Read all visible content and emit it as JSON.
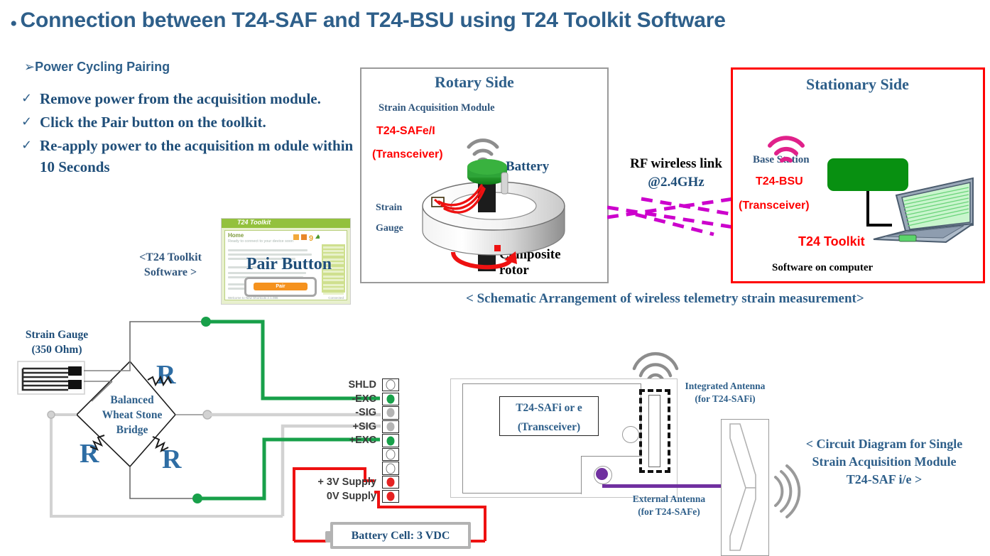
{
  "title": {
    "bullet": "•",
    "text": "Connection between T24-SAF and T24-BSU using T24 Toolkit Software",
    "color": "#2E5F8A"
  },
  "instructions": {
    "heading_arrow": "➢",
    "heading": "Power Cycling  Pairing",
    "check_glyph": "✓",
    "steps": [
      "Remove power from the acquisition module.",
      "Click the Pair button on the toolkit.",
      "Re-apply power to the acquisition m odule within 10 Seconds"
    ]
  },
  "toolkit_screenshot": {
    "window_title": "T24 Toolkit",
    "home_label": "Home",
    "subtitle": "Ready to connect to your device soon",
    "pair_button": "Pair",
    "footer_left": "Welcome to New Shortcuts 2.1.086",
    "footer_right": "Connected",
    "overlay_label": "Pair Button",
    "caption": "<T24 Toolkit Software >"
  },
  "rotary": {
    "panel_title": "Rotary Side",
    "module_label": "Strain Acquisition Module",
    "device_label": "T24-SAFe/I",
    "device_sub": "(Transceiver)",
    "battery_label": "Battery",
    "strain_label": "Strain",
    "gauge_label": "Gauge",
    "rotor_label": "Composite rotor",
    "border_color": "#9a9a9a"
  },
  "rf_link": {
    "line1": "RF wireless link",
    "line2": "@2.4GHz",
    "dash_color": "#CC00CC"
  },
  "stationary": {
    "panel_title": "Stationary  Side",
    "base_station_label": "Base Station",
    "device_label": "T24-BSU",
    "device_sub": "(Transceiver)",
    "toolkit_label": "T24 Toolkit",
    "software_label": "Software  on computer",
    "border_color": "#FF0000"
  },
  "schematic_caption": "< Schematic Arrangement of wireless telemetry strain measurement>",
  "circuit": {
    "strain_gauge_label": "Strain Gauge (350 Ohm)",
    "bridge_label": "Balanced Wheat Stone Bridge",
    "resistor_label": "R",
    "resistors": [
      "R",
      "R",
      "R"
    ],
    "terminals": [
      {
        "label": "SHLD",
        "dot": "empty"
      },
      {
        "label": "-EXC",
        "dot": "green"
      },
      {
        "label": "-SIG",
        "dot": "grey"
      },
      {
        "label": "+SIG",
        "dot": "grey"
      },
      {
        "label": "+EXC",
        "dot": "green"
      },
      {
        "label": "",
        "dot": "empty"
      },
      {
        "label": "",
        "dot": "empty"
      },
      {
        "label": "+ 3V Supply",
        "dot": "red"
      },
      {
        "label": "0V Supply",
        "dot": "red"
      }
    ],
    "module_label_line1": "T24-SAFi  or e",
    "module_label_line2": "(Transceiver)",
    "integrated_antenna_label": "Integrated Antenna (for T24-SAFi)",
    "external_antenna_label": "External Antenna (for T24-SAFe)",
    "battery_cell_label": "Battery  Cell: 3 VDC",
    "caption": "< Circuit Diagram for Single Strain Acquisition Module T24-SAF i/e >",
    "wire_green": "#18A04A",
    "wire_grey": "#d0d0d0",
    "wire_red": "#EE1111",
    "wire_purple": "#7030A0"
  }
}
